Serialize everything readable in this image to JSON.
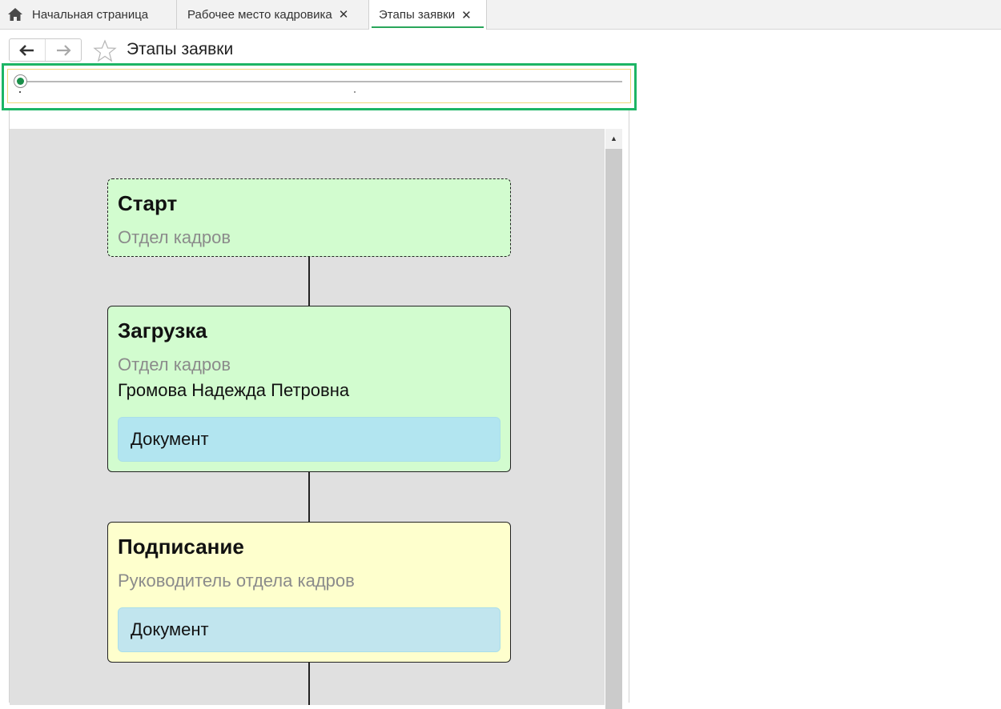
{
  "tabs": {
    "home_label": "Начальная страница",
    "work_label": "Рабочее место кадровика",
    "active_label": "Этапы заявки",
    "close_glyph": "✕"
  },
  "toolbar": {
    "title": "Этапы заявки"
  },
  "slider": {
    "value_fraction": 0.0
  },
  "diagram": {
    "stages": [
      {
        "title": "Старт",
        "department": "Отдел кадров"
      },
      {
        "title": "Загрузка",
        "department": "Отдел кадров",
        "person": "Громова Надежда Петровна",
        "document": "Документ"
      },
      {
        "title": "Подписание",
        "department": "Руководитель отдела кадров",
        "document": "Документ"
      }
    ]
  },
  "colors": {
    "accent": "#1db565",
    "stage_done": "#d2fccf",
    "stage_current": "#feffcd",
    "document": "#b2e5f0"
  }
}
